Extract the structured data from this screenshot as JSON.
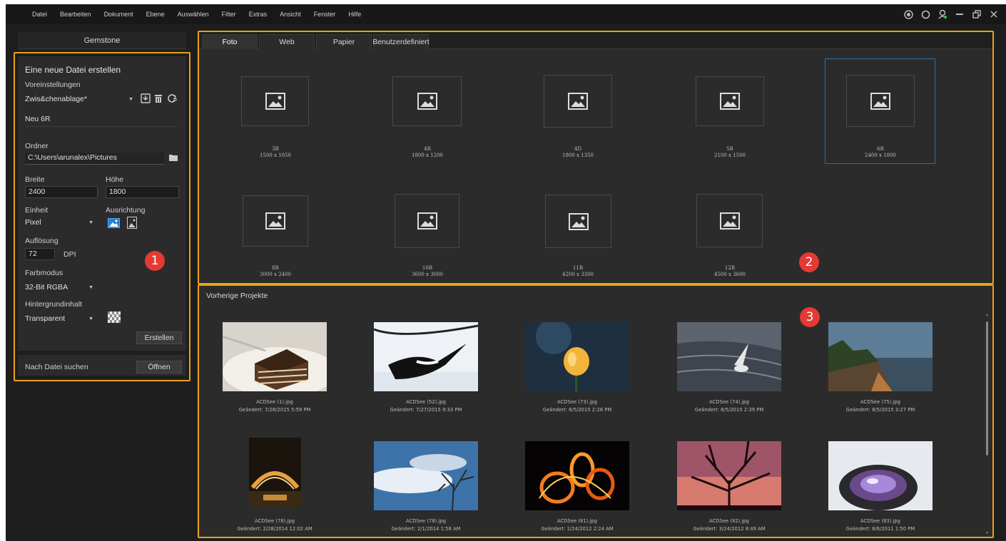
{
  "menubar": {
    "items": [
      "Datei",
      "Bearbeiten",
      "Dokument",
      "Ebene",
      "Auswählen",
      "Filter",
      "Extras",
      "Ansicht",
      "Fenster",
      "Hilfe"
    ],
    "window_icons": [
      "smiley-icon",
      "circle-icon",
      "user-icon",
      "minimize-icon",
      "restore-icon",
      "close-icon"
    ]
  },
  "left": {
    "gemstone_tab": "Gemstone",
    "section_title": "Eine neue Datei erstellen",
    "presets_label": "Voreinstellungen",
    "preset_value": "Zwis&chenablage*",
    "preset_name": "Neu 6R",
    "folder_label": "Ordner",
    "folder_value": "C:\\Users\\arunalex\\Pictures",
    "width_label": "Breite",
    "width_value": "2400",
    "height_label": "Höhe",
    "height_value": "1800",
    "unit_label": "Einheit",
    "unit_value": "Pixel",
    "orientation_label": "Ausrichtung",
    "resolution_label": "Auflösung",
    "resolution_value": "72",
    "resolution_unit": "DPI",
    "color_mode_label": "Farbmodus",
    "color_mode_value": "32-Bit RGBA",
    "background_label": "Hintergrundinhalt",
    "background_value": "Transparent",
    "create_button": "Erstellen",
    "search_label": "Nach Datei suchen",
    "open_button": "Öffnen",
    "badge": "1"
  },
  "templates": {
    "tabs": [
      "Foto",
      "Web",
      "Papier",
      "Benutzerdefiniert"
    ],
    "active_tab": "Foto",
    "selected": "6R",
    "items": [
      {
        "name": "3R",
        "size": "1500 x 1050"
      },
      {
        "name": "4R",
        "size": "1800 x 1200"
      },
      {
        "name": "4D",
        "size": "1800 x 1350"
      },
      {
        "name": "5R",
        "size": "2100 x 1500"
      },
      {
        "name": "6R",
        "size": "2400 x 1800"
      },
      {
        "name": "8R",
        "size": "3000 x 2400"
      },
      {
        "name": "10R",
        "size": "3600 x 3000"
      },
      {
        "name": "11R",
        "size": "4200 x 3300"
      },
      {
        "name": "12R",
        "size": "4500 x 3600"
      }
    ],
    "badge": "2"
  },
  "recent": {
    "title": "Vorherige Projekte",
    "badge": "3",
    "items": [
      {
        "file": "ACDSee (1).jpg",
        "modified": "Geändert: 7/28/2015 5:59 PM"
      },
      {
        "file": "ACDSee (52).jpg",
        "modified": "Geändert: 7/27/2015 9:33 PM"
      },
      {
        "file": "ACDSee (73).jpg",
        "modified": "Geändert: 8/5/2015 2:28 PM"
      },
      {
        "file": "ACDSee (74).jpg",
        "modified": "Geändert: 8/5/2015 2:39 PM"
      },
      {
        "file": "ACDSee (75).jpg",
        "modified": "Geändert: 8/5/2015 3:27 PM"
      },
      {
        "file": "ACDSee (76).jpg",
        "modified": "Geändert: 2/28/2014 12:02 AM"
      },
      {
        "file": "ACDSee (78).jpg",
        "modified": "Geändert: 2/1/2014 1:58 AM"
      },
      {
        "file": "ACDSee (81).jpg",
        "modified": "Geändert: 1/24/2012 2:24 AM"
      },
      {
        "file": "ACDSee (82).jpg",
        "modified": "Geändert: 3/24/2012 8:49 AM"
      },
      {
        "file": "ACDSee (83).jpg",
        "modified": "Geändert: 8/6/2011 1:50 PM"
      }
    ]
  },
  "colors": {
    "highlight": "#e8a317",
    "badge": "#e53935",
    "selection": "#2f6ea5"
  }
}
